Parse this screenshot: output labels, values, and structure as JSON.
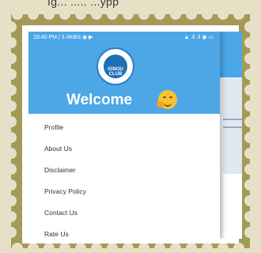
{
  "top_strip_text": "Ig... ..... ...ypp",
  "status_bar": {
    "left": "10:40 PM | 3.4KB/s ◉ ▶",
    "right": "▲ .il .il ◉ ▭"
  },
  "drawer": {
    "logo_text": "IGNOU CLUB",
    "welcome": "Welcome"
  },
  "menu": [
    {
      "label": "Profile"
    },
    {
      "label": "About Us"
    },
    {
      "label": "Disclaimer"
    },
    {
      "label": "Privacy Policy"
    },
    {
      "label": "Contact Us"
    },
    {
      "label": "Rate Us"
    }
  ],
  "colors": {
    "stamp_border": "#a49a58",
    "header_blue": "#4da7e6",
    "stamp_bg": "#e6e1c6"
  },
  "emoji_icon": "hugging-face-icon"
}
